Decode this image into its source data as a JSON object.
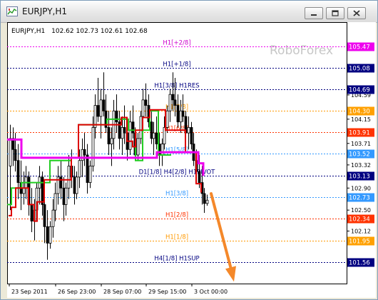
{
  "window": {
    "title": "EURJPY,H1",
    "buttons": [
      {
        "name": "minimize",
        "icon": "minimize-icon"
      },
      {
        "name": "restore",
        "icon": "restore-icon"
      },
      {
        "name": "close",
        "icon": "close-icon"
      }
    ]
  },
  "chart_header": {
    "symbol": "EURJPY,H1",
    "ohlc": "102.62 102.73 102.61 102.68"
  },
  "watermark": "RoboForex",
  "colors": {
    "candles": "#000000",
    "green_line": "#22cc22",
    "red_line": "#dd0000",
    "magenta_line": "#ee00ee",
    "arrow": "#f4882a",
    "axis_box": "#000080",
    "grid": "#9aa2c0"
  },
  "chart_data": {
    "type": "line",
    "title": "EURJPY,H1",
    "y_range": [
      101.4,
      105.6
    ],
    "x_labels": [
      "23 Sep 2011",
      "26 Sep 23:00",
      "28 Sep 07:00",
      "29 Sep 15:00",
      "3 Oct 00:00"
    ],
    "y_ticks": [
      104.59,
      104.15,
      103.71,
      103.32,
      102.9,
      102.5,
      102.12,
      101.56
    ],
    "levels": [
      {
        "label": "H1[+2/8]",
        "price": "105.47",
        "color": "#ee00ee",
        "box_bg": "#ee00ee",
        "label_color": "#cc00cc"
      },
      {
        "label": "H1[+1/8]",
        "price": "105.08",
        "color": "#000080",
        "box_bg": "#000080",
        "label_color": "#000080"
      },
      {
        "label": "H1[3/8] H1RES",
        "price": "104.69",
        "color": "#000080",
        "box_bg": "#000080",
        "label_color": "#000080"
      },
      {
        "label": "H1[7/8]",
        "price": "104.30",
        "color": "#ff9900",
        "box_bg": "#ffa000",
        "label_color": "#ff9900"
      },
      {
        "label": "H1[6/8]",
        "price": "103.91",
        "color": "#ff3300",
        "box_bg": "#ff3300",
        "label_color": "#ff3300"
      },
      {
        "label": "H1[5/8]",
        "price": "103.52",
        "color": "#3399ff",
        "box_bg": "#3399ff",
        "label_color": "#3399ff"
      },
      {
        "label": "D1[1/8] H4[2/8] H1PIVOT",
        "price": "103.13",
        "color": "#000080",
        "box_bg": "#000080",
        "label_color": "#000080"
      },
      {
        "label": "H1[3/8]",
        "price": "102.73",
        "color": "#3399ff",
        "box_bg": "#3399ff",
        "label_color": "#3399ff"
      },
      {
        "label": "H1[2/8]",
        "price": "102.34",
        "color": "#ff3300",
        "box_bg": "#ff3300",
        "label_color": "#ff3300"
      },
      {
        "label": "H1[1/8]",
        "price": "101.95",
        "color": "#ff9900",
        "box_bg": "#ffa000",
        "label_color": "#ff9900"
      },
      {
        "label": "H4[1/8] H1SUP",
        "price": "101.56",
        "color": "#000080",
        "box_bg": "#000080",
        "label_color": "#000080"
      }
    ],
    "series": [
      {
        "name": "",
        "color": "#22cc22",
        "values": [
          [
            0,
            102.6
          ],
          [
            6,
            102.6
          ],
          [
            6,
            102.9
          ],
          [
            20,
            102.9
          ],
          [
            20,
            103.0
          ],
          [
            60,
            103.0
          ],
          [
            60,
            103.4
          ],
          [
            90,
            103.4
          ],
          [
            90,
            103.45
          ],
          [
            100,
            103.45
          ],
          [
            100,
            104.05
          ],
          [
            140,
            104.05
          ],
          [
            140,
            104.15
          ],
          [
            170,
            104.15
          ],
          [
            170,
            103.95
          ],
          [
            180,
            103.95
          ],
          [
            180,
            103.4
          ],
          [
            190,
            103.4
          ],
          [
            190,
            103.95
          ],
          [
            200,
            103.95
          ],
          [
            200,
            104.3
          ],
          [
            212,
            104.3
          ],
          [
            212,
            103.5
          ],
          [
            230,
            103.5
          ]
        ]
      },
      {
        "name": "",
        "color": "#dd0000",
        "values": [
          [
            2,
            102.4
          ],
          [
            6,
            102.4
          ],
          [
            6,
            102.55
          ],
          [
            12,
            102.55
          ],
          [
            12,
            102.9
          ],
          [
            30,
            102.9
          ],
          [
            30,
            102.6
          ],
          [
            38,
            102.6
          ],
          [
            38,
            102.3
          ],
          [
            42,
            102.3
          ],
          [
            42,
            102.65
          ],
          [
            52,
            102.65
          ],
          [
            52,
            103.05
          ],
          [
            90,
            103.05
          ],
          [
            90,
            103.45
          ],
          [
            100,
            103.45
          ],
          [
            100,
            104.05
          ],
          [
            160,
            104.05
          ],
          [
            160,
            104.18
          ],
          [
            168,
            104.18
          ],
          [
            168,
            103.75
          ],
          [
            176,
            103.75
          ],
          [
            176,
            103.65
          ],
          [
            180,
            103.65
          ],
          [
            180,
            103.95
          ],
          [
            190,
            103.95
          ],
          [
            190,
            104.18
          ],
          [
            200,
            104.18
          ],
          [
            200,
            104.32
          ],
          [
            222,
            104.32
          ],
          [
            222,
            103.95
          ],
          [
            250,
            103.95
          ],
          [
            250,
            103.55
          ],
          [
            265,
            103.55
          ],
          [
            265,
            102.98
          ],
          [
            272,
            102.98
          ],
          [
            272,
            102.82
          ]
        ]
      },
      {
        "name": "",
        "color": "#ee00ee",
        "values": [
          [
            0,
            103.78
          ],
          [
            20,
            103.78
          ],
          [
            20,
            103.45
          ],
          [
            210,
            103.45
          ],
          [
            210,
            103.55
          ],
          [
            268,
            103.55
          ],
          [
            268,
            103.35
          ],
          [
            275,
            103.35
          ],
          [
            275,
            103.12
          ]
        ]
      }
    ],
    "candles": [
      [
        103.3,
        104.05,
        102.5,
        103.8
      ],
      [
        103.8,
        104.0,
        103.3,
        103.6
      ],
      [
        103.6,
        103.9,
        103.2,
        103.4
      ],
      [
        103.4,
        103.7,
        102.7,
        103.0
      ],
      [
        103.0,
        103.4,
        102.5,
        102.8
      ],
      [
        102.8,
        103.2,
        102.6,
        102.9
      ],
      [
        102.9,
        103.3,
        102.7,
        103.1
      ],
      [
        103.1,
        103.2,
        102.4,
        102.6
      ],
      [
        102.6,
        102.9,
        102.1,
        102.3
      ],
      [
        102.3,
        102.7,
        101.95,
        102.5
      ],
      [
        102.5,
        103.0,
        102.3,
        102.9
      ],
      [
        102.9,
        103.3,
        102.6,
        103.1
      ],
      [
        103.1,
        103.2,
        102.4,
        102.6
      ],
      [
        102.6,
        102.8,
        101.9,
        102.2
      ],
      [
        102.2,
        102.5,
        101.6,
        101.9
      ],
      [
        101.9,
        102.3,
        101.8,
        102.2
      ],
      [
        102.2,
        102.7,
        102.0,
        102.5
      ],
      [
        102.5,
        103.0,
        102.3,
        102.8
      ],
      [
        102.8,
        103.3,
        102.6,
        103.1
      ],
      [
        103.1,
        103.4,
        102.7,
        102.9
      ],
      [
        102.9,
        103.1,
        102.3,
        102.6
      ],
      [
        102.6,
        103.0,
        102.4,
        102.9
      ],
      [
        102.9,
        103.5,
        102.7,
        103.3
      ],
      [
        103.3,
        103.6,
        102.9,
        103.1
      ],
      [
        103.1,
        103.3,
        102.6,
        102.8
      ],
      [
        102.8,
        103.2,
        102.7,
        103.1
      ],
      [
        103.1,
        103.6,
        102.9,
        103.4
      ],
      [
        103.4,
        103.8,
        103.1,
        103.6
      ],
      [
        103.6,
        103.9,
        103.3,
        103.5
      ],
      [
        103.5,
        103.7,
        102.8,
        103.0
      ],
      [
        103.0,
        103.4,
        102.9,
        103.3
      ],
      [
        103.3,
        104.2,
        103.2,
        104.0
      ],
      [
        104.0,
        104.6,
        103.8,
        104.4
      ],
      [
        104.4,
        104.9,
        104.1,
        104.2
      ],
      [
        104.2,
        104.7,
        103.8,
        104.5
      ],
      [
        104.5,
        105.0,
        104.2,
        104.3
      ],
      [
        104.3,
        104.6,
        103.9,
        104.0
      ],
      [
        104.0,
        104.3,
        103.5,
        103.7
      ],
      [
        103.7,
        104.0,
        103.3,
        103.8
      ],
      [
        103.8,
        104.5,
        103.6,
        104.3
      ],
      [
        104.3,
        104.6,
        103.9,
        104.1
      ],
      [
        104.1,
        104.3,
        103.6,
        103.8
      ],
      [
        103.8,
        104.2,
        103.5,
        104.0
      ],
      [
        104.0,
        104.4,
        103.7,
        103.9
      ],
      [
        103.9,
        104.1,
        103.4,
        103.6
      ],
      [
        103.6,
        104.3,
        103.5,
        104.1
      ],
      [
        104.1,
        104.4,
        103.8,
        103.9
      ],
      [
        103.9,
        104.0,
        103.4,
        103.5
      ],
      [
        103.5,
        103.9,
        103.4,
        103.8
      ],
      [
        103.8,
        104.3,
        103.7,
        104.2
      ],
      [
        104.2,
        104.7,
        104.0,
        104.5
      ],
      [
        104.5,
        104.8,
        104.2,
        104.4
      ],
      [
        104.4,
        104.6,
        104.0,
        104.1
      ],
      [
        104.1,
        104.3,
        103.7,
        103.8
      ],
      [
        103.8,
        104.1,
        103.5,
        103.9
      ],
      [
        103.9,
        104.2,
        103.6,
        103.7
      ],
      [
        103.7,
        103.9,
        103.3,
        103.5
      ],
      [
        103.5,
        103.8,
        103.3,
        103.7
      ],
      [
        103.7,
        104.2,
        103.6,
        104.0
      ],
      [
        104.0,
        104.4,
        103.9,
        104.3
      ],
      [
        104.3,
        104.7,
        104.1,
        104.6
      ],
      [
        104.6,
        105.0,
        104.3,
        104.5
      ],
      [
        104.5,
        104.9,
        104.2,
        104.4
      ],
      [
        104.4,
        104.6,
        104.0,
        104.1
      ],
      [
        104.1,
        104.5,
        103.9,
        104.3
      ],
      [
        104.3,
        104.6,
        104.1,
        104.2
      ],
      [
        104.2,
        104.3,
        103.8,
        103.9
      ],
      [
        103.9,
        104.2,
        103.6,
        104.0
      ],
      [
        104.0,
        104.1,
        103.6,
        103.7
      ],
      [
        103.7,
        103.9,
        103.3,
        103.4
      ],
      [
        103.4,
        103.6,
        103.0,
        103.2
      ],
      [
        103.2,
        103.5,
        102.9,
        103.0
      ],
      [
        103.0,
        103.3,
        102.6,
        102.8
      ],
      [
        102.8,
        102.9,
        102.45,
        102.62
      ],
      [
        102.62,
        102.78,
        102.58,
        102.68
      ]
    ],
    "arrow": {
      "from": [
        286,
        102.8
      ],
      "to": [
        318,
        101.2
      ]
    }
  }
}
